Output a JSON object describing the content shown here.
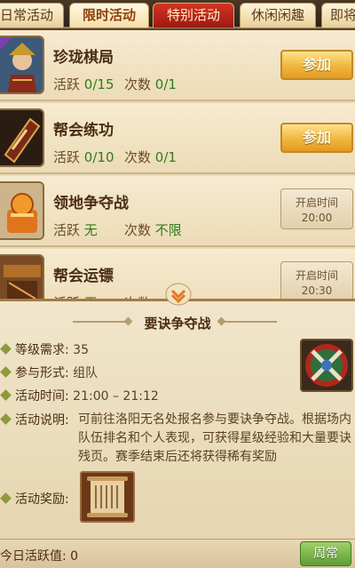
{
  "tabs": [
    {
      "label": "日常活动",
      "state": "normal"
    },
    {
      "label": "限时活动",
      "state": "active"
    },
    {
      "label": "特别活动",
      "state": "special"
    },
    {
      "label": "休闲闲趣",
      "state": "normal"
    },
    {
      "label": "即将",
      "state": "normal"
    }
  ],
  "activities": [
    {
      "title": "珍珑棋局",
      "activity_label": "活跃",
      "activity_value": "0/15",
      "count_label": "次数",
      "count_value": "0/1",
      "action": "参加",
      "icon": "general-portrait-icon"
    },
    {
      "title": "帮会练功",
      "activity_label": "活跃",
      "activity_value": "0/10",
      "count_label": "次数",
      "count_value": "0/1",
      "action": "参加",
      "icon": "guild-token-icon"
    },
    {
      "title": "领地争夺战",
      "activity_label": "活跃",
      "activity_value": "无",
      "count_label": "次数",
      "count_value": "不限",
      "open_label": "开启时间",
      "open_time": "20:00",
      "icon": "seal-icon"
    },
    {
      "title": "帮会运镖",
      "activity_label": "活跃",
      "activity_value": "无",
      "count_label": "次数",
      "count_value": "",
      "open_label": "开启时间",
      "open_time": "20:30",
      "icon": "escort-icon"
    }
  ],
  "detail": {
    "title": "要诀争夺战",
    "level_label": "等级需求:",
    "level_value": "35",
    "form_label": "参与形式:",
    "form_value": "组队",
    "time_label": "活动时间:",
    "time_value": "21:00 – 21:12",
    "desc_label": "活动说明:",
    "desc_value": "可前往洛阳无名处报名参与要诀争夺战。根据场内队伍排名和个人表现，可获得星级经验和大量要诀残页。赛季结束后还将获得稀有奖励",
    "reward_label": "活动奖励:"
  },
  "footer": {
    "daily_label": "今日活跃值: 0",
    "weekly_button": "周常"
  },
  "colors": {
    "accent": "#e39b22",
    "value_green": "#2f7d1c",
    "special_tab": "#c22a1e"
  }
}
